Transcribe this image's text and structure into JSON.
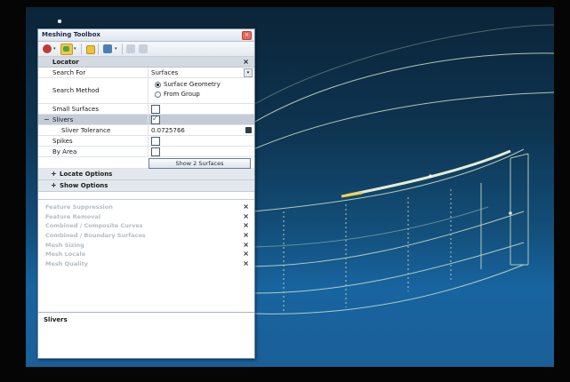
{
  "toolbox": {
    "title": "Meshing Toolbox",
    "close_glyph": "×",
    "dropdown_glyph": "▾",
    "locator": {
      "header": "Locator",
      "close_glyph": "×",
      "search_for_label": "Search For",
      "search_for_value": "Surfaces",
      "search_method_label": "Search Method",
      "search_method_options": [
        "Surface Geometry",
        "From Group"
      ],
      "small_surfaces_label": "Small Surfaces",
      "small_surfaces_checked": false,
      "slivers_label": "Slivers",
      "slivers_checked": true,
      "slivers_collapse_glyph": "−",
      "sliver_tolerance_label": "Sliver Tolerance",
      "sliver_tolerance_value": "0.0725766",
      "spikes_label": "Spikes",
      "spikes_checked": false,
      "by_area_label": "By Area",
      "by_area_checked": false,
      "show_button_label": "Show 2 Surfaces",
      "locate_options_label": "Locate Options",
      "show_options_label": "Show Options",
      "expand_glyph": "+"
    },
    "tools": [
      {
        "label": "Feature Suppression",
        "close_glyph": "×"
      },
      {
        "label": "Feature Removal",
        "close_glyph": "×"
      },
      {
        "label": "Combined / Composite Curves",
        "close_glyph": "×"
      },
      {
        "label": "Combined / Boundary Surfaces",
        "close_glyph": "×"
      },
      {
        "label": "Mesh Sizing",
        "close_glyph": "×"
      },
      {
        "label": "Mesh Locale",
        "close_glyph": "×"
      },
      {
        "label": "Mesh Quality",
        "close_glyph": "×"
      }
    ],
    "help_label": "Slivers"
  },
  "colors": {
    "viewport_top": "#0b2438",
    "viewport_bottom": "#1864a0",
    "wire": "#cfe0c8",
    "highlight": "#e7ecd2"
  }
}
